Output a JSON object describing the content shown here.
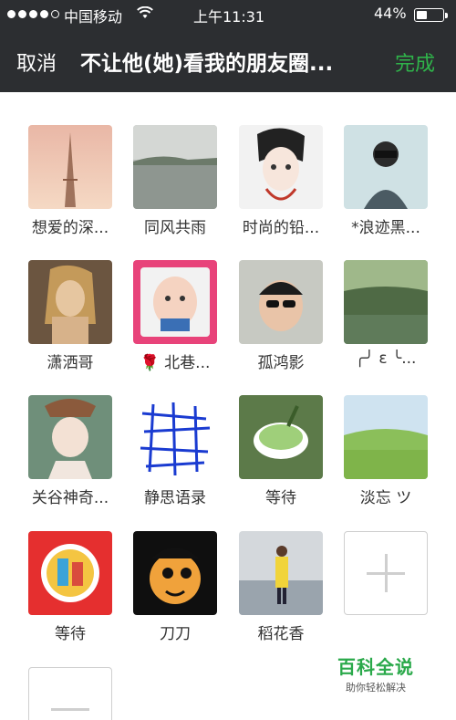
{
  "status_bar": {
    "carrier": "中国移动",
    "time": "上午11:31",
    "battery_percent_text": "44%",
    "battery_level": 0.44
  },
  "nav": {
    "cancel_label": "取消",
    "title": "不让他(她)看我的朋友圈...",
    "done_label": "完成"
  },
  "friends": [
    {
      "name": "想爱的深..."
    },
    {
      "name": "同风共雨"
    },
    {
      "name": "时尚的铅..."
    },
    {
      "name": "*浪迹黑..."
    },
    {
      "name": "潇洒哥"
    },
    {
      "name": "🌹 北巷..."
    },
    {
      "name": "孤鸿影"
    },
    {
      "name": "╭╯ ε ╰..."
    },
    {
      "name": "关谷神奇..."
    },
    {
      "name": "静思语录"
    },
    {
      "name": "等待"
    },
    {
      "name": "淡忘 ツ"
    },
    {
      "name": "等待"
    },
    {
      "name": "刀刀"
    },
    {
      "name": "稻花香"
    }
  ],
  "watermark": {
    "main": "百科全说",
    "sub": "助你轻松解决"
  },
  "colors": {
    "header_bg": "#2c2e31",
    "done_green": "#2fb44a",
    "watermark_green": "#2aa94a"
  }
}
